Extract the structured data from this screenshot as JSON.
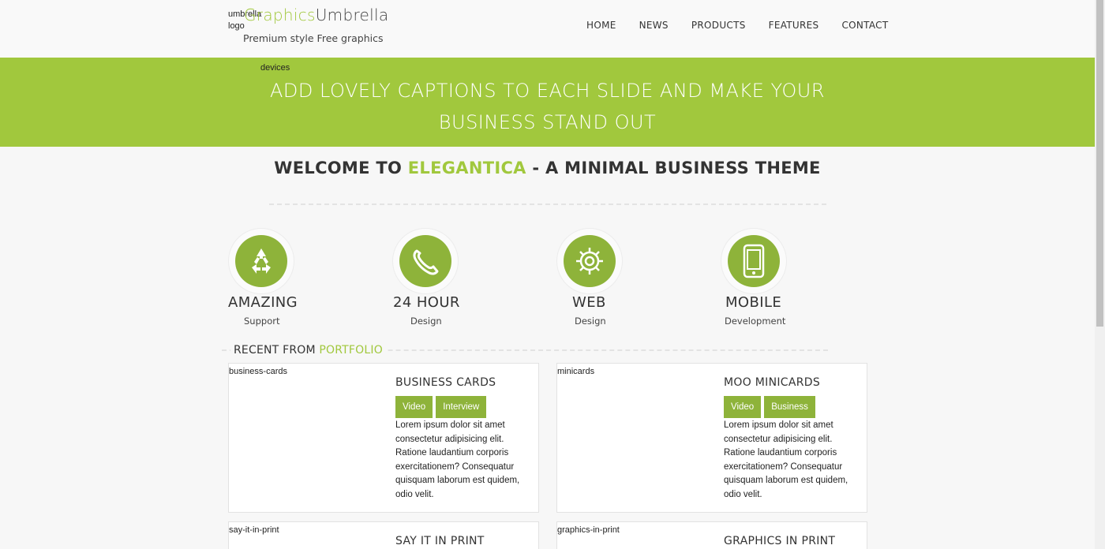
{
  "header": {
    "logo_alt": "umbrella logo",
    "logo_title_green": "Graphics",
    "logo_title_dark": "Umbrella",
    "tagline": "Premium style Free graphics"
  },
  "nav": {
    "items": [
      {
        "label": "HOME"
      },
      {
        "label": "NEWS"
      },
      {
        "label": "PRODUCTS"
      },
      {
        "label": "FEATURES"
      },
      {
        "label": "CONTACT"
      }
    ]
  },
  "banner": {
    "image_alt": "devices",
    "caption_line1": "ADD LOVELY CAPTIONS TO EACH SLIDE AND MAKE YOUR",
    "caption_line2": "BUSINESS STAND OUT"
  },
  "welcome": {
    "prefix": "WELCOME TO ",
    "highlight": "ELEGANTICA",
    "suffix": " - A MINIMAL BUSINESS THEME"
  },
  "features": [
    {
      "icon": "recycle-icon",
      "title": "AMAZING",
      "subtitle": "Support"
    },
    {
      "icon": "phone-icon",
      "title": "24 HOUR",
      "subtitle": "Design"
    },
    {
      "icon": "gear-icon",
      "title": "WEB",
      "subtitle": "Design"
    },
    {
      "icon": "mobile-icon",
      "title": "MOBILE",
      "subtitle": "Development"
    }
  ],
  "portfolio": {
    "heading_prefix": "RECENT FROM",
    "heading_highlight": "PORTFOLIO",
    "items": [
      {
        "image_alt": "business-cards",
        "title": "BUSINESS CARDS",
        "tags": [
          "Video",
          "Interview"
        ],
        "description": "Lorem ipsum dolor sit amet consectetur adipisicing elit. Ratione laudantium corporis exercitationem? Consequatur quisquam laborum est quidem, odio velit."
      },
      {
        "image_alt": "minicards",
        "title": "MOO MINICARDS",
        "tags": [
          "Video",
          "Business"
        ],
        "description": "Lorem ipsum dolor sit amet consectetur adipisicing elit. Ratione laudantium corporis exercitationem? Consequatur quisquam laborum est quidem, odio velit."
      },
      {
        "image_alt": "say-it-in-print",
        "title": "SAY IT IN PRINT"
      },
      {
        "image_alt": "graphics-in-print",
        "title": "GRAPHICS IN PRINT"
      }
    ]
  },
  "colors": {
    "accent": "#a1c83d",
    "icon_fill": "#8eb33a",
    "text": "#333333"
  }
}
